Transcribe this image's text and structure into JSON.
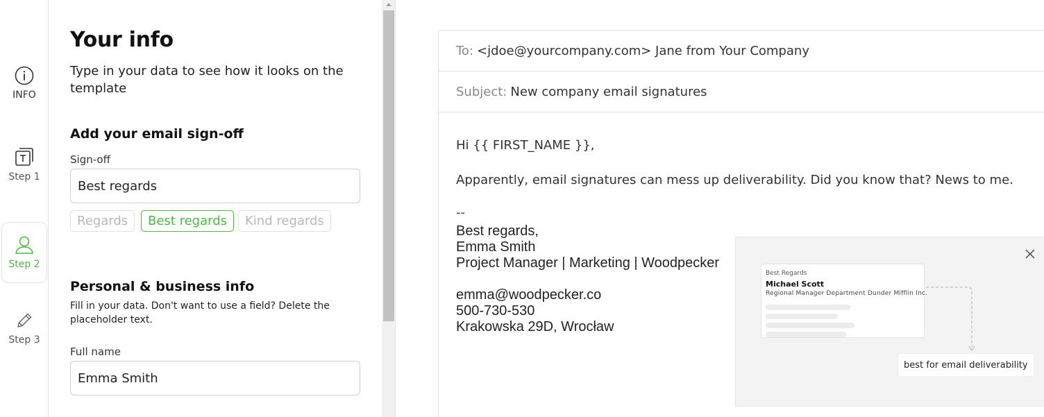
{
  "rail": {
    "info_label": "INFO",
    "step1_label": "Step 1",
    "step2_label": "Step 2",
    "step3_label": "Step 3",
    "active_step": "Step 2"
  },
  "form": {
    "title": "Your info",
    "subtitle": "Type in your data to see how it looks on the template",
    "signoff_section": "Add your email sign-off",
    "signoff_label": "Sign-off",
    "signoff_value": "Best regards",
    "signoff_options": [
      "Regards",
      "Best regards",
      "Kind regards"
    ],
    "selected_option": "Best regards",
    "personal_section": "Personal & business info",
    "personal_desc": "Fill in your data. Don't want to use a field? Delete the placeholder text.",
    "fullname_label": "Full name",
    "fullname_value": "Emma Smith"
  },
  "email": {
    "to_key": "To:",
    "to_value": "<jdoe@yourcompany.com> Jane from Your Company",
    "subject_key": "Subject:",
    "subject_value": "New company email signatures",
    "greeting": "Hi {{ FIRST_NAME }},",
    "body": "Apparently, email signatures can mess up deliverability. Did you know that? News to me.",
    "separator": "--",
    "signature": {
      "signoff": "Best regards,",
      "name": "Emma Smith",
      "role": "Project Manager | Marketing | Woodpecker",
      "email": "emma@woodpecker.co",
      "phone": "500-730-530",
      "address": "Krakowska 29D, Wrocław"
    }
  },
  "hint": {
    "card_signoff": "Best Regards",
    "card_name": "Michael Scott",
    "card_details": "Regional Manager  Department  Dunder Mifflin Inc.",
    "badge": "best for email deliverability"
  },
  "colors": {
    "accent": "#4cb944",
    "border": "#e2e2e2",
    "muted_text": "#888888",
    "hint_bg": "#f3f3f3"
  },
  "icons": [
    "info-icon",
    "text-box-icon",
    "user-icon",
    "pencil-icon",
    "close-icon"
  ]
}
